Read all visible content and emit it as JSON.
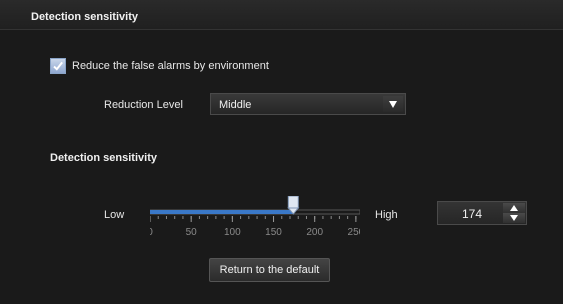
{
  "header": {
    "title": "Detection sensitivity"
  },
  "options": {
    "reduce_false_alarms": {
      "label": "Reduce the false alarms by environment",
      "checked": true
    },
    "reduction_level": {
      "label": "Reduction Level",
      "selected": "Middle"
    }
  },
  "sensitivity": {
    "title": "Detection sensitivity",
    "low_label": "Low",
    "high_label": "High",
    "value": "174",
    "min": 0,
    "max": 255,
    "ticks": [
      "0",
      "50",
      "100",
      "150",
      "200",
      "250"
    ]
  },
  "actions": {
    "reset_label": "Return to the default"
  },
  "colors": {
    "accent": "#3a78c8",
    "background": "#1b1b1b"
  }
}
